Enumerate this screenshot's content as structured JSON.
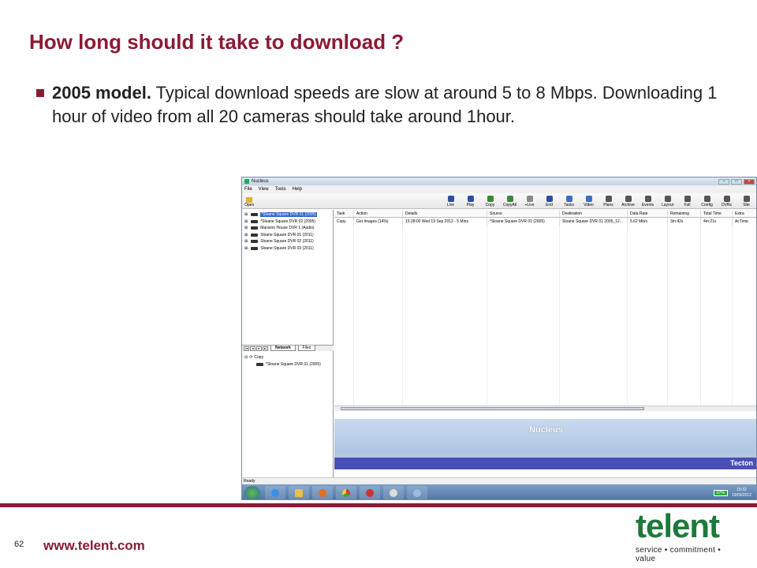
{
  "slide": {
    "title": "How long should it take to download ?",
    "bullet_bold": "2005 model.",
    "bullet_text": " Typical download speeds are slow at around 5 to 8 Mbps. Downloading 1 hour of video from all 20 cameras should take around 1hour.",
    "page_number": "62",
    "url": "www.telent.com",
    "logo_word": "telent",
    "logo_tag": "service • commitment • value"
  },
  "app": {
    "window_title": "Nucleus",
    "menu": [
      "File",
      "View",
      "Tools",
      "Help"
    ],
    "open_label": "Open",
    "toolbar": [
      {
        "label": "Live",
        "color": "#2c4fa0"
      },
      {
        "label": "Play",
        "color": "#2c4fa0"
      },
      {
        "label": "Copy",
        "color": "#3a8a3a"
      },
      {
        "label": "CopyAll",
        "color": "#3a8a3a"
      },
      {
        "label": "+Live",
        "color": "#888888"
      },
      {
        "label": "End",
        "color": "#2c4fa0"
      },
      {
        "label": "Tasks",
        "color": "#3a6ec0"
      },
      {
        "label": "Video",
        "color": "#3a6ec0"
      },
      {
        "label": "Plans",
        "color": "#555555"
      },
      {
        "label": "Archive",
        "color": "#555555"
      },
      {
        "label": "Events",
        "color": "#555555"
      },
      {
        "label": "Layout",
        "color": "#555555"
      },
      {
        "label": "Full",
        "color": "#555555"
      },
      {
        "label": "Config",
        "color": "#555555"
      },
      {
        "label": "DVRs",
        "color": "#555555"
      },
      {
        "label": "Site",
        "color": "#555555"
      }
    ],
    "tree": [
      {
        "label": "*Sloane Square DVR 01 (2005)",
        "selected": true
      },
      {
        "label": "*Sloane Square DVR 02 (2005)",
        "selected": false
      },
      {
        "label": "Mansion House DVR 1 (Audio)",
        "selected": false
      },
      {
        "label": "Sloane Square DVR 01 (2011)",
        "selected": false
      },
      {
        "label": "Sloane Square DVR 02 (2011)",
        "selected": false
      },
      {
        "label": "Sloane Square DVR 03 (2011)",
        "selected": false
      }
    ],
    "tabs": [
      "Network",
      "Files"
    ],
    "lower_tree": {
      "parent": "Copy",
      "child": "*Sloane Square DVR 01 (2005)"
    },
    "columns": [
      "Task",
      "Action",
      "Details",
      "Source",
      "Destination",
      "Data Rate",
      "Remaining",
      "Total Time",
      "Extra"
    ],
    "rows": [
      [
        "Copy",
        "Get Images (14%)",
        "15:28:00 Wed 19 Sep 2012 - 5 Mins",
        "*Sloane Square DVR 01 (2005)",
        "Sloane Square DVR 01 2005_12...",
        "5.62 Mb/s",
        "3m:42s",
        "4m:21s",
        "At Time"
      ]
    ],
    "banner_title": "Nucleus",
    "banner_brand": "Tecton",
    "status": "Ready",
    "battery": "97%",
    "clock_time": "15:32",
    "clock_date": "19/09/2012"
  }
}
